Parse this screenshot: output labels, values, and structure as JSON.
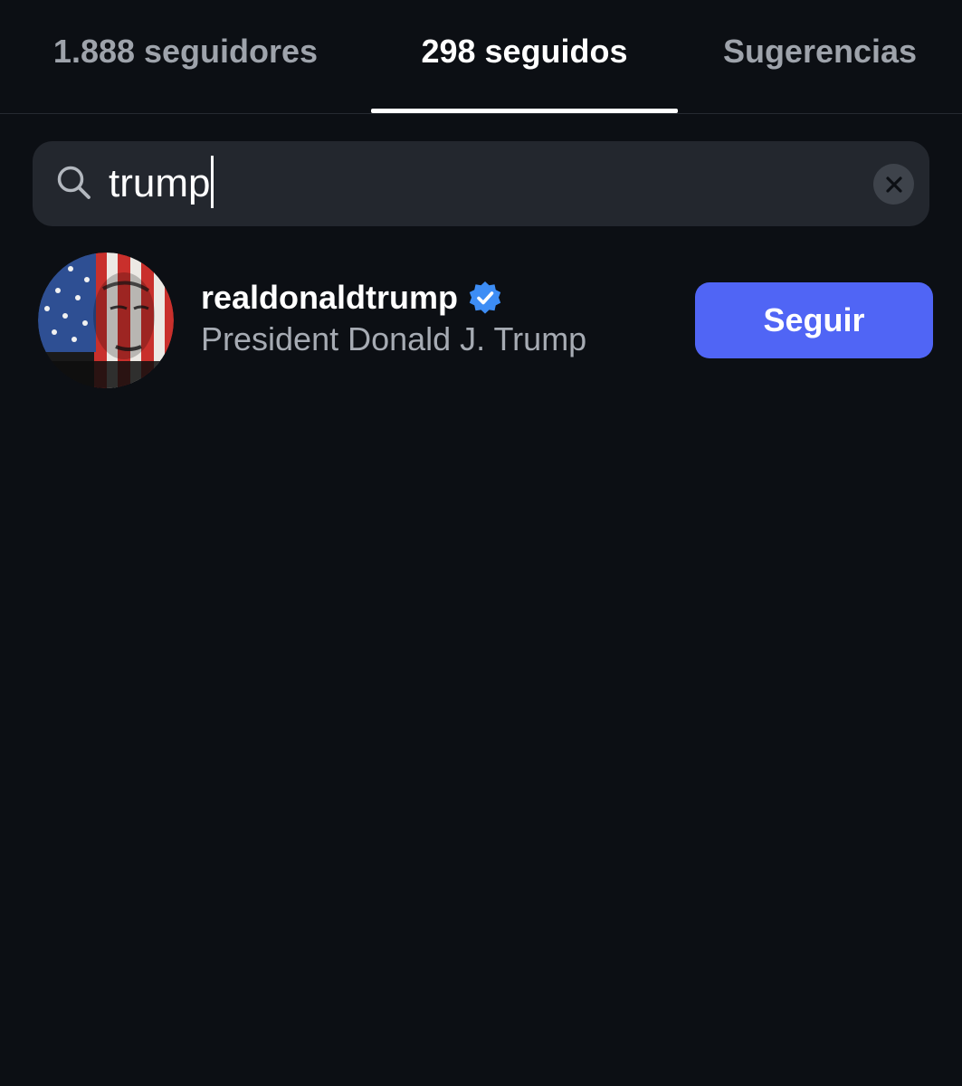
{
  "tabs": [
    {
      "label": "1.888 seguidores",
      "active": false
    },
    {
      "label": "298 seguidos",
      "active": true
    },
    {
      "label": "Sugerencias",
      "active": false
    }
  ],
  "search": {
    "value": "trump",
    "icon": "search-icon",
    "clear_icon": "close-icon"
  },
  "results": [
    {
      "username": "realdonaldtrump",
      "verified": true,
      "display_name": "President Donald J. Trump",
      "follow_label": "Seguir"
    }
  ],
  "colors": {
    "background": "#0c0f14",
    "search_bg": "#23272e",
    "accent_button": "#5065f5",
    "verified_badge": "#3d8df5",
    "muted_text": "#a6abb3"
  }
}
